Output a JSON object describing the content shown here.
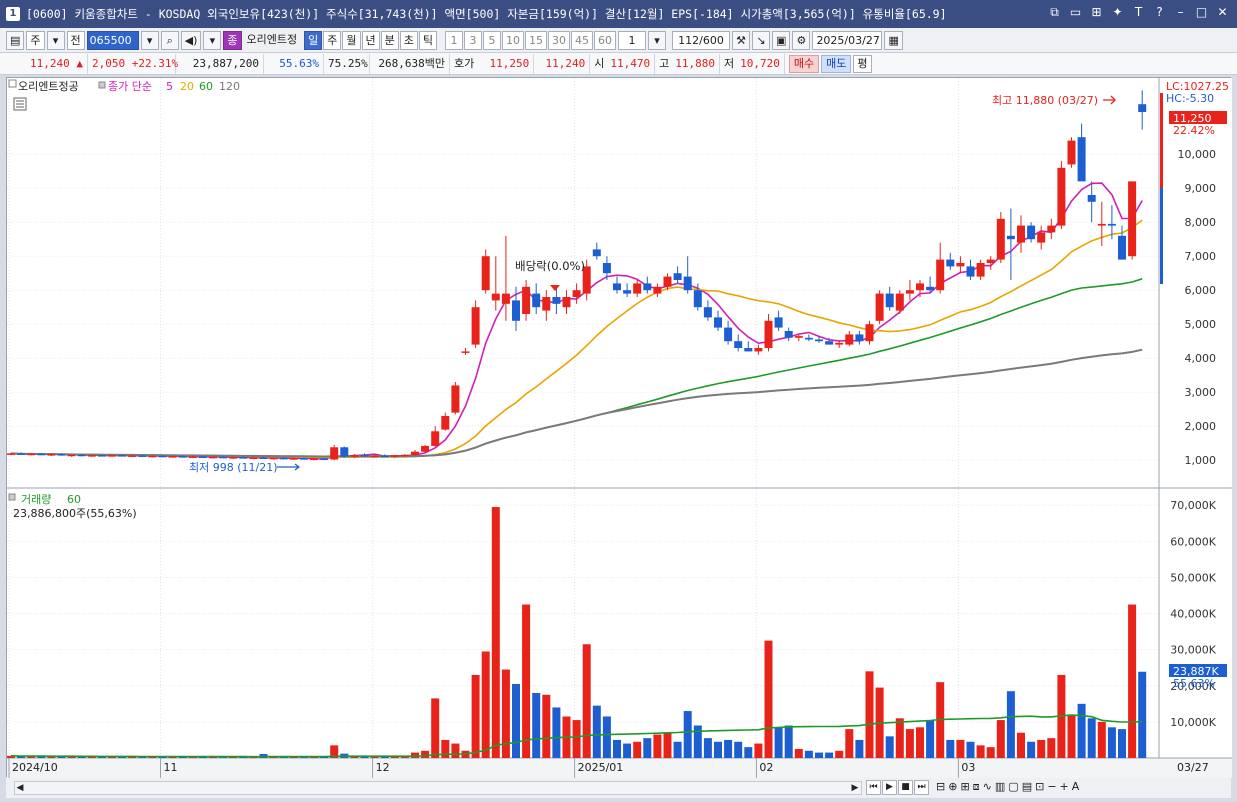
{
  "window": {
    "number": "1",
    "title": "[0600] 키움종합차트 - KOSDAQ 외국인보유[423(천)] 주식수[31,743(천)] 액면[500] 자본금[159(억)] 결산[12월] EPS[-184] 시가총액[3,565(억)] 유통비율[65.9]"
  },
  "toolbar": {
    "period_type": "주",
    "prev_label": "전",
    "code": "065500",
    "stock_name_badge": "종",
    "stock_name": "오리엔트정",
    "period_buttons": [
      "일",
      "주",
      "월",
      "년",
      "분",
      "초",
      "틱"
    ],
    "selected_period": "일",
    "minute_buttons": [
      "1",
      "3",
      "5",
      "10",
      "15",
      "30",
      "45",
      "60"
    ],
    "interval_value": "1",
    "count": "112/600",
    "date": "2025/03/27"
  },
  "quote": {
    "price": "11,240",
    "change_arrow": "▲",
    "change": "2,050",
    "change_pct": "+22.31%",
    "volume": "23,887,200",
    "volume_ratio": "55.63%",
    "turnover": "75.25%",
    "amount": "268,638백만",
    "bid_label": "호가",
    "ask_price": "11,250",
    "bid_price": "11,240",
    "open_label": "시",
    "open": "11,470",
    "high_label": "고",
    "high": "11,880",
    "low_label": "저",
    "low": "10,720",
    "buy_label": "매수",
    "sell_label": "매도",
    "avg_label": "평"
  },
  "legend": {
    "stock_tab": "오리엔트정공",
    "ma_label": "종가 단순",
    "ma_periods": [
      "5",
      "20",
      "60",
      "120"
    ],
    "ma_colors": [
      "#d11fb8",
      "#e8a500",
      "#1f9a2a",
      "#7a7a7a"
    ],
    "volume_label": "거래량",
    "volume_ma": "60",
    "volume_value": "23,886,800주(55,63%)"
  },
  "annotations": {
    "high_marker": "최고 11,880 (03/27)",
    "low_marker": "최저 998 (11/21)",
    "dividend_marker": "배당락(0.0%)",
    "lc": "LC:1027.25",
    "hc": "HC:-5.30",
    "last_price": "11,250",
    "last_pct": "22.42%",
    "vol_last": "23,887K",
    "vol_last_pct": "55.63%"
  },
  "axis": {
    "price_ticks": [
      "10,000",
      "9,000",
      "8,000",
      "7,000",
      "6,000",
      "5,000",
      "4,000",
      "3,000",
      "2,000",
      "1,000"
    ],
    "volume_ticks": [
      "70,000K",
      "60,000K",
      "50,000K",
      "40,000K",
      "30,000K",
      "20,000K",
      "10,000K"
    ],
    "x_labels": [
      "2024/10",
      "11",
      "12",
      "2025/01",
      "02",
      "03"
    ],
    "x_end_label": "03/27"
  },
  "colors": {
    "up": "#e8231a",
    "down": "#1d5fd1",
    "title_bg": "#3b4e83"
  },
  "chart_data": {
    "type": "candlestick",
    "price_ylim": [
      0,
      12000
    ],
    "volume_ylim": [
      0,
      72000
    ],
    "volume_unit": "K",
    "ma_periods": [
      5,
      20,
      60,
      120
    ],
    "candles": [
      {
        "o": 1180,
        "h": 1220,
        "l": 1150,
        "c": 1200,
        "v": 600
      },
      {
        "o": 1200,
        "h": 1230,
        "l": 1160,
        "c": 1170,
        "v": 500
      },
      {
        "o": 1170,
        "h": 1200,
        "l": 1140,
        "c": 1190,
        "v": 500
      },
      {
        "o": 1190,
        "h": 1210,
        "l": 1150,
        "c": 1160,
        "v": 450
      },
      {
        "o": 1160,
        "h": 1190,
        "l": 1120,
        "c": 1180,
        "v": 500
      },
      {
        "o": 1180,
        "h": 1200,
        "l": 1130,
        "c": 1140,
        "v": 450
      },
      {
        "o": 1140,
        "h": 1170,
        "l": 1100,
        "c": 1160,
        "v": 400
      },
      {
        "o": 1160,
        "h": 1180,
        "l": 1110,
        "c": 1120,
        "v": 400
      },
      {
        "o": 1120,
        "h": 1160,
        "l": 1100,
        "c": 1150,
        "v": 400
      },
      {
        "o": 1150,
        "h": 1170,
        "l": 1110,
        "c": 1130,
        "v": 350
      },
      {
        "o": 1130,
        "h": 1160,
        "l": 1100,
        "c": 1150,
        "v": 400
      },
      {
        "o": 1150,
        "h": 1170,
        "l": 1110,
        "c": 1120,
        "v": 350
      },
      {
        "o": 1120,
        "h": 1150,
        "l": 1090,
        "c": 1140,
        "v": 350
      },
      {
        "o": 1140,
        "h": 1160,
        "l": 1100,
        "c": 1110,
        "v": 350
      },
      {
        "o": 1110,
        "h": 1140,
        "l": 1080,
        "c": 1130,
        "v": 350
      },
      {
        "o": 1130,
        "h": 1150,
        "l": 1090,
        "c": 1100,
        "v": 300
      },
      {
        "o": 1100,
        "h": 1140,
        "l": 1080,
        "c": 1120,
        "v": 350
      },
      {
        "o": 1120,
        "h": 1140,
        "l": 1080,
        "c": 1090,
        "v": 300
      },
      {
        "o": 1090,
        "h": 1120,
        "l": 1060,
        "c": 1110,
        "v": 300
      },
      {
        "o": 1110,
        "h": 1130,
        "l": 1070,
        "c": 1080,
        "v": 300
      },
      {
        "o": 1080,
        "h": 1110,
        "l": 1050,
        "c": 1100,
        "v": 300
      },
      {
        "o": 1100,
        "h": 1120,
        "l": 1060,
        "c": 1070,
        "v": 250
      },
      {
        "o": 1070,
        "h": 1100,
        "l": 1040,
        "c": 1090,
        "v": 300
      },
      {
        "o": 1090,
        "h": 1110,
        "l": 1050,
        "c": 1060,
        "v": 250
      },
      {
        "o": 1060,
        "h": 1090,
        "l": 1030,
        "c": 1080,
        "v": 300
      },
      {
        "o": 1080,
        "h": 1100,
        "l": 1040,
        "c": 1050,
        "v": 1100
      },
      {
        "o": 1050,
        "h": 1080,
        "l": 1020,
        "c": 1070,
        "v": 300
      },
      {
        "o": 1070,
        "h": 1090,
        "l": 1030,
        "c": 1040,
        "v": 250
      },
      {
        "o": 1040,
        "h": 1080,
        "l": 1010,
        "c": 1060,
        "v": 300
      },
      {
        "o": 1060,
        "h": 1080,
        "l": 1020,
        "c": 1030,
        "v": 250
      },
      {
        "o": 1030,
        "h": 1070,
        "l": 1000,
        "c": 1050,
        "v": 300
      },
      {
        "o": 1050,
        "h": 1070,
        "l": 998,
        "c": 1010,
        "v": 350
      },
      {
        "o": 1020,
        "h": 1450,
        "l": 1000,
        "c": 1380,
        "v": 3500
      },
      {
        "o": 1380,
        "h": 1400,
        "l": 1080,
        "c": 1100,
        "v": 1200
      },
      {
        "o": 1100,
        "h": 1180,
        "l": 1060,
        "c": 1150,
        "v": 600
      },
      {
        "o": 1150,
        "h": 1200,
        "l": 1100,
        "c": 1120,
        "v": 500
      },
      {
        "o": 1120,
        "h": 1160,
        "l": 1080,
        "c": 1130,
        "v": 500
      },
      {
        "o": 1130,
        "h": 1170,
        "l": 1090,
        "c": 1100,
        "v": 450
      },
      {
        "o": 1100,
        "h": 1150,
        "l": 1070,
        "c": 1140,
        "v": 500
      },
      {
        "o": 1140,
        "h": 1180,
        "l": 1100,
        "c": 1160,
        "v": 600
      },
      {
        "o": 1160,
        "h": 1300,
        "l": 1130,
        "c": 1250,
        "v": 1500
      },
      {
        "o": 1250,
        "h": 1450,
        "l": 1230,
        "c": 1420,
        "v": 2000
      },
      {
        "o": 1420,
        "h": 2000,
        "l": 1400,
        "c": 1850,
        "v": 16500
      },
      {
        "o": 1900,
        "h": 2400,
        "l": 1870,
        "c": 2300,
        "v": 5000
      },
      {
        "o": 2400,
        "h": 3300,
        "l": 2350,
        "c": 3200,
        "v": 4000
      },
      {
        "o": 4200,
        "h": 4300,
        "l": 4100,
        "c": 4200,
        "v": 2000
      },
      {
        "o": 4400,
        "h": 5700,
        "l": 4300,
        "c": 5500,
        "v": 23000
      },
      {
        "o": 6000,
        "h": 7200,
        "l": 5900,
        "c": 7000,
        "v": 29500
      },
      {
        "o": 5700,
        "h": 7000,
        "l": 5400,
        "c": 5900,
        "v": 69500
      },
      {
        "o": 5600,
        "h": 7600,
        "l": 5100,
        "c": 5900,
        "v": 24500
      },
      {
        "o": 5700,
        "h": 6100,
        "l": 4800,
        "c": 5100,
        "v": 20500
      },
      {
        "o": 5300,
        "h": 6300,
        "l": 5100,
        "c": 6100,
        "v": 42500
      },
      {
        "o": 5900,
        "h": 6200,
        "l": 5300,
        "c": 5500,
        "v": 18000
      },
      {
        "o": 5400,
        "h": 6000,
        "l": 5100,
        "c": 5800,
        "v": 17500
      },
      {
        "o": 5800,
        "h": 6100,
        "l": 5300,
        "c": 5600,
        "v": 14000
      },
      {
        "o": 5500,
        "h": 6000,
        "l": 5300,
        "c": 5800,
        "v": 11500
      },
      {
        "o": 5800,
        "h": 6200,
        "l": 5600,
        "c": 6000,
        "v": 10500
      },
      {
        "o": 5900,
        "h": 6900,
        "l": 5700,
        "c": 6700,
        "v": 31500
      },
      {
        "o": 7200,
        "h": 7400,
        "l": 6900,
        "c": 7000,
        "v": 14500
      },
      {
        "o": 6800,
        "h": 7000,
        "l": 6300,
        "c": 6500,
        "v": 11500
      },
      {
        "o": 6200,
        "h": 6400,
        "l": 5900,
        "c": 6000,
        "v": 5000
      },
      {
        "o": 6000,
        "h": 6200,
        "l": 5800,
        "c": 5900,
        "v": 4000
      },
      {
        "o": 5900,
        "h": 6300,
        "l": 5800,
        "c": 6200,
        "v": 4500
      },
      {
        "o": 6200,
        "h": 6400,
        "l": 5900,
        "c": 6000,
        "v": 5500
      },
      {
        "o": 5900,
        "h": 6200,
        "l": 5800,
        "c": 6100,
        "v": 6500
      },
      {
        "o": 6100,
        "h": 6500,
        "l": 6000,
        "c": 6400,
        "v": 7000
      },
      {
        "o": 6500,
        "h": 6700,
        "l": 6200,
        "c": 6300,
        "v": 4500
      },
      {
        "o": 6400,
        "h": 7000,
        "l": 5900,
        "c": 6000,
        "v": 13000
      },
      {
        "o": 6000,
        "h": 6200,
        "l": 5400,
        "c": 5500,
        "v": 9000
      },
      {
        "o": 5500,
        "h": 5700,
        "l": 5100,
        "c": 5200,
        "v": 5500
      },
      {
        "o": 5200,
        "h": 5400,
        "l": 4800,
        "c": 4900,
        "v": 4500
      },
      {
        "o": 4900,
        "h": 5100,
        "l": 4400,
        "c": 4500,
        "v": 5000
      },
      {
        "o": 4500,
        "h": 4700,
        "l": 4200,
        "c": 4300,
        "v": 4500
      },
      {
        "o": 4300,
        "h": 4500,
        "l": 4200,
        "c": 4200,
        "v": 3000
      },
      {
        "o": 4200,
        "h": 4400,
        "l": 4100,
        "c": 4300,
        "v": 4000
      },
      {
        "o": 4300,
        "h": 5300,
        "l": 4200,
        "c": 5100,
        "v": 32500
      },
      {
        "o": 5200,
        "h": 5400,
        "l": 4800,
        "c": 4900,
        "v": 8500
      },
      {
        "o": 4800,
        "h": 4900,
        "l": 4500,
        "c": 4600,
        "v": 9000
      },
      {
        "o": 4600,
        "h": 4700,
        "l": 4500,
        "c": 4650,
        "v": 2500
      },
      {
        "o": 4600,
        "h": 4700,
        "l": 4500,
        "c": 4550,
        "v": 2000
      },
      {
        "o": 4550,
        "h": 4650,
        "l": 4450,
        "c": 4500,
        "v": 1500
      },
      {
        "o": 4500,
        "h": 4600,
        "l": 4400,
        "c": 4400,
        "v": 1500
      },
      {
        "o": 4400,
        "h": 4500,
        "l": 4300,
        "c": 4450,
        "v": 2000
      },
      {
        "o": 4400,
        "h": 4800,
        "l": 4350,
        "c": 4700,
        "v": 8000
      },
      {
        "o": 4700,
        "h": 4800,
        "l": 4400,
        "c": 4500,
        "v": 5000
      },
      {
        "o": 4500,
        "h": 5100,
        "l": 4400,
        "c": 5000,
        "v": 24000
      },
      {
        "o": 5100,
        "h": 6000,
        "l": 5000,
        "c": 5900,
        "v": 19500
      },
      {
        "o": 5900,
        "h": 6100,
        "l": 5400,
        "c": 5500,
        "v": 6000
      },
      {
        "o": 5400,
        "h": 6000,
        "l": 5300,
        "c": 5900,
        "v": 11000
      },
      {
        "o": 5900,
        "h": 6300,
        "l": 5700,
        "c": 6000,
        "v": 8000
      },
      {
        "o": 6000,
        "h": 6300,
        "l": 5800,
        "c": 6200,
        "v": 8500
      },
      {
        "o": 6100,
        "h": 6400,
        "l": 5900,
        "c": 6000,
        "v": 10500
      },
      {
        "o": 6000,
        "h": 7400,
        "l": 5900,
        "c": 6900,
        "v": 21000
      },
      {
        "o": 6900,
        "h": 7100,
        "l": 6600,
        "c": 6700,
        "v": 5000
      },
      {
        "o": 6700,
        "h": 7000,
        "l": 6500,
        "c": 6800,
        "v": 5000
      },
      {
        "o": 6700,
        "h": 6900,
        "l": 6300,
        "c": 6400,
        "v": 4500
      },
      {
        "o": 6400,
        "h": 6900,
        "l": 6300,
        "c": 6800,
        "v": 3500
      },
      {
        "o": 6800,
        "h": 7000,
        "l": 6600,
        "c": 6900,
        "v": 3000
      },
      {
        "o": 6900,
        "h": 8300,
        "l": 6800,
        "c": 8100,
        "v": 10500
      },
      {
        "o": 7600,
        "h": 8400,
        "l": 6300,
        "c": 7500,
        "v": 18500
      },
      {
        "o": 7400,
        "h": 8200,
        "l": 7100,
        "c": 7900,
        "v": 7000
      },
      {
        "o": 7900,
        "h": 8000,
        "l": 7400,
        "c": 7500,
        "v": 4500
      },
      {
        "o": 7400,
        "h": 7900,
        "l": 7200,
        "c": 7700,
        "v": 5000
      },
      {
        "o": 7700,
        "h": 8100,
        "l": 7500,
        "c": 7900,
        "v": 5500
      },
      {
        "o": 7900,
        "h": 9800,
        "l": 7800,
        "c": 9600,
        "v": 23000
      },
      {
        "o": 9700,
        "h": 10500,
        "l": 9600,
        "c": 10400,
        "v": 12000
      },
      {
        "o": 10500,
        "h": 10900,
        "l": 9300,
        "c": 9200,
        "v": 15000
      },
      {
        "o": 8800,
        "h": 9200,
        "l": 8000,
        "c": 8600,
        "v": 11000
      },
      {
        "o": 7900,
        "h": 8600,
        "l": 7300,
        "c": 7950,
        "v": 10000
      },
      {
        "o": 7950,
        "h": 8500,
        "l": 7500,
        "c": 7900,
        "v": 8500
      },
      {
        "o": 7600,
        "h": 7900,
        "l": 6900,
        "c": 6900,
        "v": 8000
      },
      {
        "o": 7000,
        "h": 9200,
        "l": 6900,
        "c": 9200,
        "v": 42500
      },
      {
        "o": 11470,
        "h": 11880,
        "l": 10720,
        "c": 11240,
        "v": 23887
      }
    ]
  }
}
